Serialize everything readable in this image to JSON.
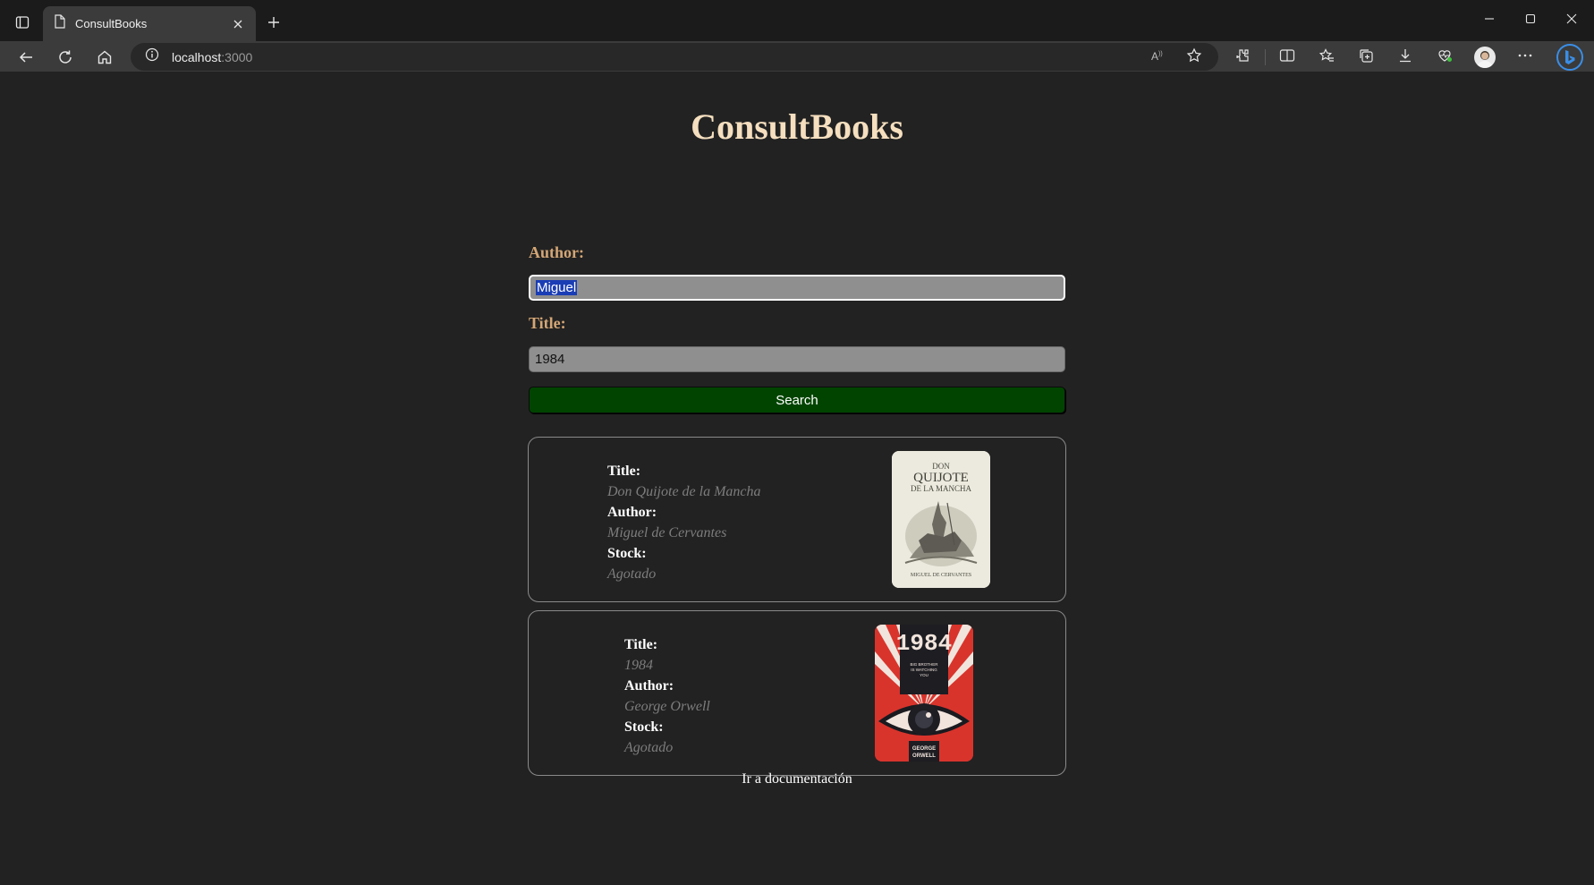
{
  "browser": {
    "tab_title": "ConsultBooks",
    "url_host": "localhost",
    "url_port": ":3000"
  },
  "page": {
    "heading": "ConsultBooks",
    "author_label": "Author:",
    "author_value": "Miguel",
    "title_label": "Title:",
    "title_value": "1984",
    "search_label": "Search",
    "doc_link": "Ir a documentación"
  },
  "results": [
    {
      "title_label": "Title:",
      "title": "Don Quijote de la Mancha",
      "author_label": "Author:",
      "author": "Miguel de Cervantes",
      "stock_label": "Stock:",
      "stock": "Agotado",
      "cover": {
        "line1": "DON",
        "line2": "QUIJOTE",
        "line3": "DE LA MANCHA",
        "footer": "MIGUEL DE CERVANTES"
      }
    },
    {
      "title_label": "Title:",
      "title": "1984",
      "author_label": "Author:",
      "author": "George Orwell",
      "stock_label": "Stock:",
      "stock": "Agotado",
      "cover": {
        "heading": "1984",
        "tagline1": "BIG BROTHER",
        "tagline2": "IS WATCHING",
        "tagline3": "YOU",
        "footer1": "GEORGE",
        "footer2": "ORWELL"
      }
    }
  ],
  "colors": {
    "background": "#222222",
    "heading": "#f5dfbf",
    "label": "#d4a676",
    "search_button": "#004400",
    "result_value": "#7d7d7d"
  },
  "icons": [
    "sidebar-icon",
    "page-icon",
    "close-icon",
    "plus-icon",
    "minimize-icon",
    "maximize-icon",
    "back-icon",
    "refresh-icon",
    "home-icon",
    "info-icon",
    "read-aloud-icon",
    "star-icon",
    "extensions-icon",
    "split-screen-icon",
    "favorites-icon",
    "collections-icon",
    "download-icon",
    "performance-icon",
    "avatar",
    "more-icon",
    "bing-icon"
  ]
}
